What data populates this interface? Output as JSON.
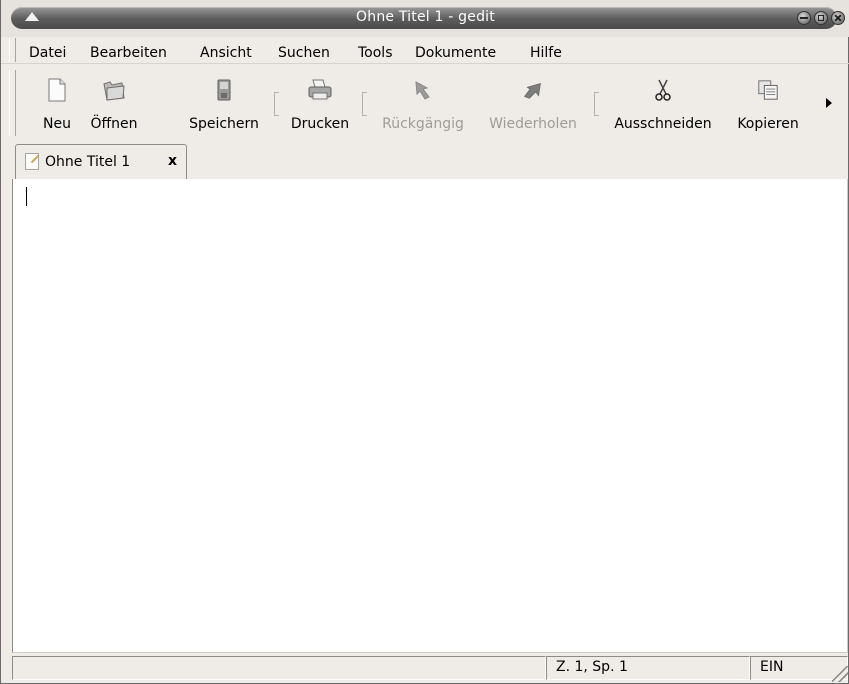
{
  "window": {
    "title": "Ohne Titel 1 - gedit"
  },
  "menubar": {
    "items": [
      "Datei",
      "Bearbeiten",
      "Ansicht",
      "Suchen",
      "Tools",
      "Dokumente",
      "Hilfe"
    ]
  },
  "toolbar": {
    "buttons": [
      {
        "label": "Neu",
        "icon": "new-document-icon",
        "enabled": true
      },
      {
        "label": "Öffnen",
        "icon": "open-folder-icon",
        "enabled": true
      },
      {
        "label": "Speichern",
        "icon": "save-icon",
        "enabled": true
      },
      {
        "label": "Drucken",
        "icon": "printer-icon",
        "enabled": true
      },
      {
        "label": "Rückgängig",
        "icon": "undo-icon",
        "enabled": false
      },
      {
        "label": "Wiederholen",
        "icon": "redo-icon",
        "enabled": false
      },
      {
        "label": "Ausschneiden",
        "icon": "scissors-icon",
        "enabled": true
      },
      {
        "label": "Kopieren",
        "icon": "copy-icon",
        "enabled": true
      }
    ]
  },
  "tabs": [
    {
      "label": "Ohne Titel 1",
      "close": "x",
      "icon": "text-document-icon"
    }
  ],
  "editor": {
    "content": ""
  },
  "statusbar": {
    "message": "",
    "position": "Z. 1, Sp. 1",
    "insert_mode": "EIN"
  },
  "colors": {
    "window_bg": "#efebe7",
    "titlebar": "#5c5c5c",
    "disabled_text": "#9e9b98"
  }
}
